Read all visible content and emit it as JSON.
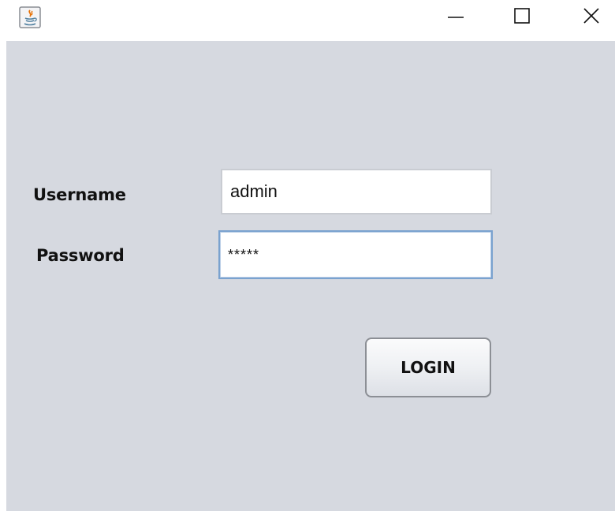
{
  "titlebar": {
    "app_icon": "java-icon",
    "minimize_icon": "minimize-icon",
    "maximize_icon": "maximize-icon",
    "close_icon": "close-icon"
  },
  "form": {
    "username_label": "Username",
    "username_value": "admin",
    "password_label": "Password",
    "password_value": "*****",
    "login_label": "LOGIN"
  },
  "colors": {
    "content_background": "#d6d9e0",
    "field_focus_border": "#7aa2cf",
    "java_orange": "#e76f00",
    "java_blue": "#5382a1"
  }
}
